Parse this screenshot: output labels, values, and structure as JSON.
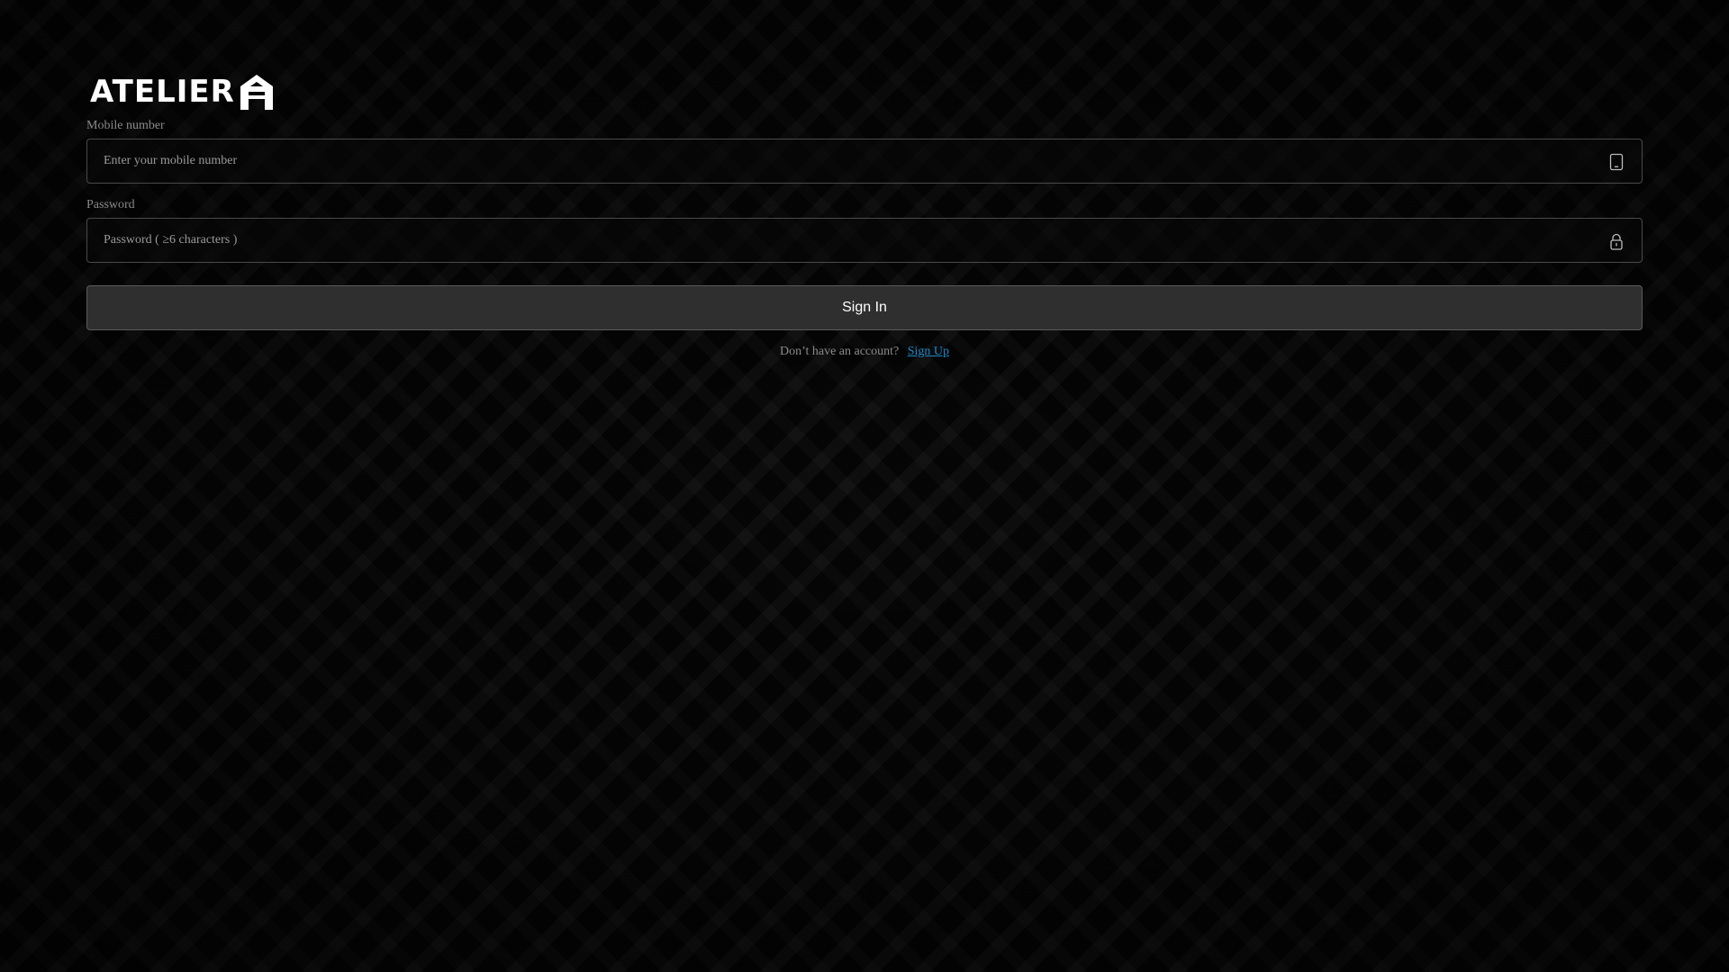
{
  "brand": {
    "name": "ATELIER",
    "logo_icon": "house-a-icon"
  },
  "mobile": {
    "label": "Mobile number",
    "placeholder": "Enter your mobile number",
    "value": "",
    "icon": "phone-icon"
  },
  "password": {
    "label": "Password",
    "placeholder": "Password ( ≥6 characters )",
    "value": "",
    "icon": "lock-icon"
  },
  "signin": {
    "label": "Sign In"
  },
  "signup": {
    "prompt": "Don’t have an account?",
    "link_label": "Sign Up"
  },
  "colors": {
    "background": "#050505",
    "link": "#1e88c7",
    "button": "#2f2f2f",
    "border": "#4a4a4a"
  }
}
